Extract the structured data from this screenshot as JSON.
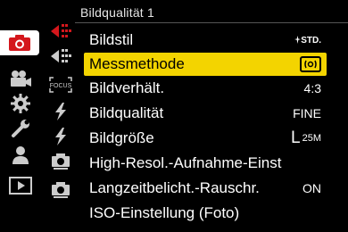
{
  "header": {
    "title": "Bildqualität 1"
  },
  "main_tabs": [
    {
      "name": "photo",
      "active": true
    },
    {
      "name": "video",
      "active": false
    },
    {
      "name": "custom",
      "active": false
    },
    {
      "name": "setup",
      "active": false
    },
    {
      "name": "my-menu",
      "active": false
    },
    {
      "name": "playback",
      "active": false
    }
  ],
  "sub_tabs": [
    {
      "label": ""
    },
    {
      "label": ""
    },
    {
      "label": "FOCUS"
    },
    {
      "label": ""
    },
    {
      "label": ""
    },
    {
      "label": ""
    },
    {
      "label": ""
    }
  ],
  "menu": {
    "items": [
      {
        "label": "Bildstil",
        "value": "STD.",
        "selected": false
      },
      {
        "label": "Messmethode",
        "value": "",
        "icon": "multi-metering-icon",
        "selected": true
      },
      {
        "label": "Bildverhält.",
        "value": "4:3",
        "selected": false
      },
      {
        "label": "Bildqualität",
        "value": "FINE",
        "selected": false
      },
      {
        "label": "Bildgröße",
        "value_main": "L",
        "value_sub": "25M",
        "selected": false
      },
      {
        "label": "High-Resol.-Aufnahme-Einst",
        "value": "",
        "selected": false
      },
      {
        "label": "Langzeitbelicht.-Rauschr.",
        "value": "ON",
        "selected": false
      },
      {
        "label": "ISO-Einstellung (Foto)",
        "value": "",
        "selected": false
      }
    ]
  },
  "colors": {
    "selection": "#f3d400",
    "accent_red": "#d4171c",
    "background": "#000000"
  }
}
